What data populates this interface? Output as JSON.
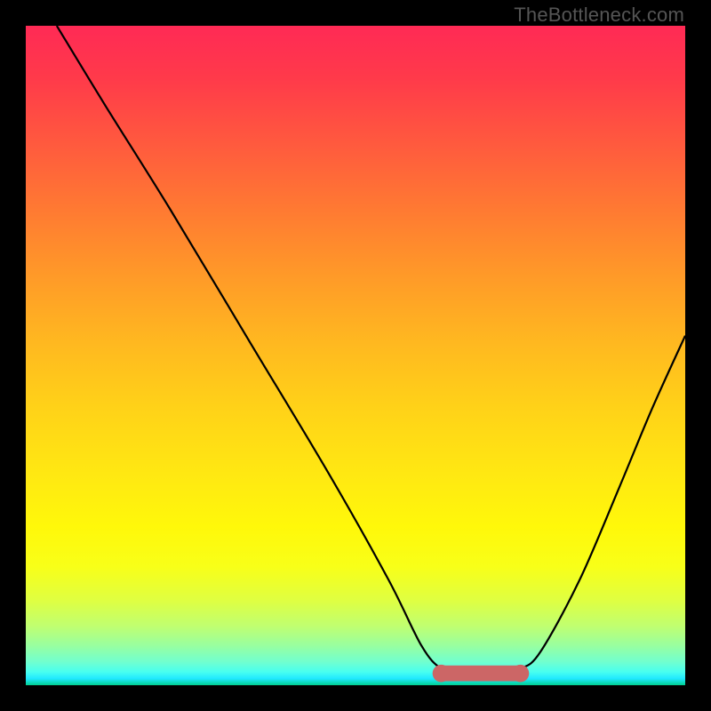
{
  "watermark": "TheBottleneck.com",
  "chart_data": {
    "type": "line",
    "title": "",
    "xlabel": "",
    "ylabel": "",
    "xlim": [
      0,
      100
    ],
    "ylim": [
      0,
      100
    ],
    "curve": [
      {
        "x": 4.7,
        "y": 100
      },
      {
        "x": 12,
        "y": 88
      },
      {
        "x": 22,
        "y": 72
      },
      {
        "x": 34,
        "y": 52
      },
      {
        "x": 46,
        "y": 32
      },
      {
        "x": 55,
        "y": 16
      },
      {
        "x": 60,
        "y": 6
      },
      {
        "x": 63,
        "y": 2.5
      },
      {
        "x": 66,
        "y": 1.7
      },
      {
        "x": 72,
        "y": 1.7
      },
      {
        "x": 75,
        "y": 2.5
      },
      {
        "x": 78,
        "y": 5
      },
      {
        "x": 84,
        "y": 16
      },
      {
        "x": 90,
        "y": 30
      },
      {
        "x": 95,
        "y": 42
      },
      {
        "x": 100,
        "y": 53
      }
    ],
    "flat_segment": {
      "x0": 63,
      "x1": 75,
      "y": 1.8,
      "color": "#cc6666",
      "thickness": 2.4
    }
  }
}
